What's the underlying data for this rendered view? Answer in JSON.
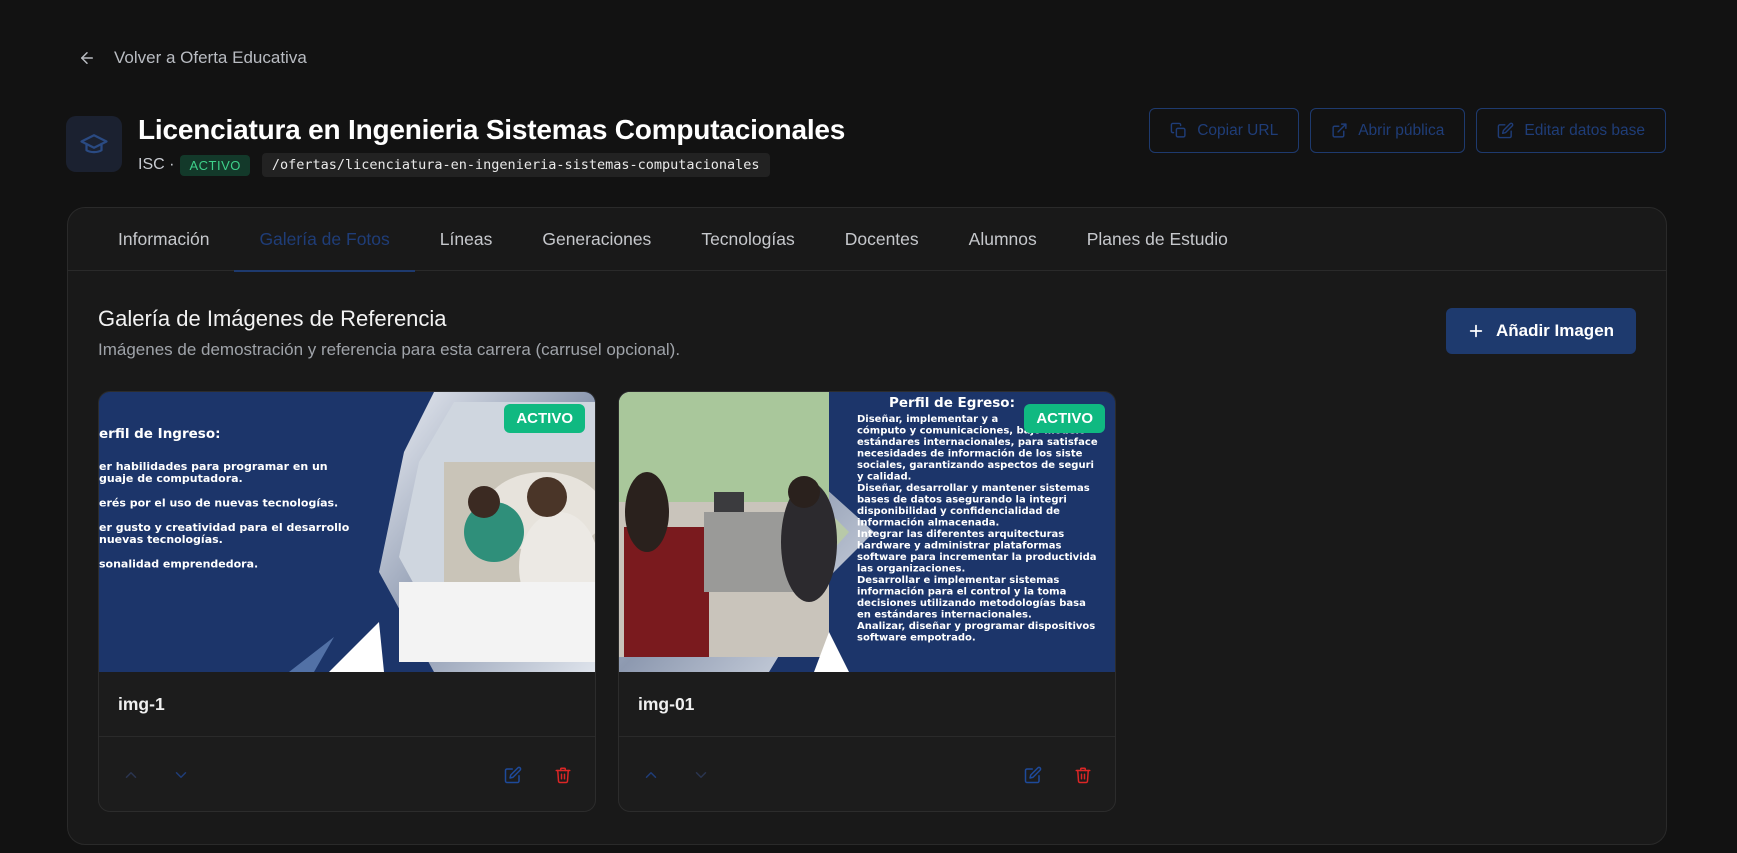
{
  "nav": {
    "back_label": "Volver a Oferta Educativa"
  },
  "program": {
    "title": "Licenciatura en Ingenieria Sistemas Computacionales",
    "code": "ISC ·",
    "status": "ACTIVO",
    "slug": "/ofertas/licenciatura-en-ingenieria-sistemas-computacionales"
  },
  "actions": {
    "copy_url": "Copiar URL",
    "open_public": "Abrir pública",
    "edit_base": "Editar datos base"
  },
  "tabs": [
    {
      "label": "Información"
    },
    {
      "label": "Galería de Fotos"
    },
    {
      "label": "Líneas"
    },
    {
      "label": "Generaciones"
    },
    {
      "label": "Tecnologías"
    },
    {
      "label": "Docentes"
    },
    {
      "label": "Alumnos"
    },
    {
      "label": "Planes de Estudio"
    }
  ],
  "gallery": {
    "title": "Galería de Imágenes de Referencia",
    "subtitle": "Imágenes de demostración y referencia para esta carrera (carrusel opcional).",
    "add_label": "Añadir Imagen",
    "images": [
      {
        "name": "img-1",
        "status": "ACTIVO",
        "heading": "erfil de Ingreso:",
        "lines": [
          "er habilidades para programar en un",
          "guaje de computadora.",
          "",
          "erés por el uso de nuevas tecnologías.",
          "",
          "er gusto y creatividad para el desarrollo",
          "nuevas tecnologías.",
          "",
          "sonalidad emprendedora."
        ]
      },
      {
        "name": "img-01",
        "status": "ACTIVO",
        "heading": "Perfil de Egreso:",
        "lines": [
          "Diseñar, implementar y a",
          "cómputo y comunicaciones, bajo modelo",
          "estándares internacionales, para satisface",
          "necesidades de información de los siste",
          "sociales, garantizando aspectos de seguri",
          "y calidad.",
          "Diseñar, desarrollar y mantener sistemas",
          "bases de datos asegurando la integri",
          "disponibilidad y confidencialidad de",
          "información almacenada.",
          "Integrar las diferentes arquitecturas",
          "hardware y administrar plataformas",
          "software para incrementar la productivida",
          "las organizaciones.",
          "Desarrollar e implementar sistemas",
          "información para el control y la toma",
          "decisiones utilizando metodologías basa",
          "en estándares internacionales.",
          "Analizar, diseñar y programar dispositivos",
          "software empotrado."
        ]
      }
    ]
  },
  "colors": {
    "accent": "#1e3a6e",
    "success": "#10b981",
    "danger": "#dc2626"
  }
}
